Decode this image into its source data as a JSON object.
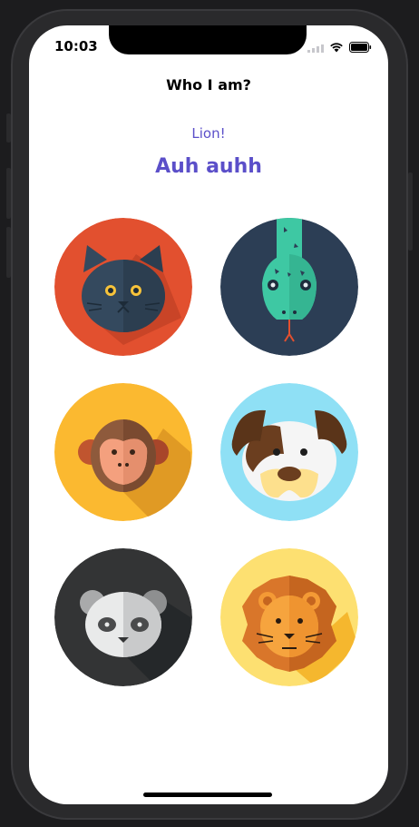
{
  "status": {
    "time": "10:03"
  },
  "header": {
    "title": "Who I am?"
  },
  "result": {
    "answer": "Lion!",
    "sound": "Auh auhh"
  },
  "animals": [
    {
      "name": "cat",
      "icon": "cat-icon",
      "bg": "#e2502f"
    },
    {
      "name": "snake",
      "icon": "snake-icon",
      "bg": "#2c3e55"
    },
    {
      "name": "monkey",
      "icon": "monkey-icon",
      "bg": "#fbb930"
    },
    {
      "name": "dog",
      "icon": "dog-icon",
      "bg": "#8fe0f5"
    },
    {
      "name": "panda",
      "icon": "panda-icon",
      "bg": "#333435"
    },
    {
      "name": "lion",
      "icon": "lion-icon",
      "bg": "#fde071"
    }
  ]
}
